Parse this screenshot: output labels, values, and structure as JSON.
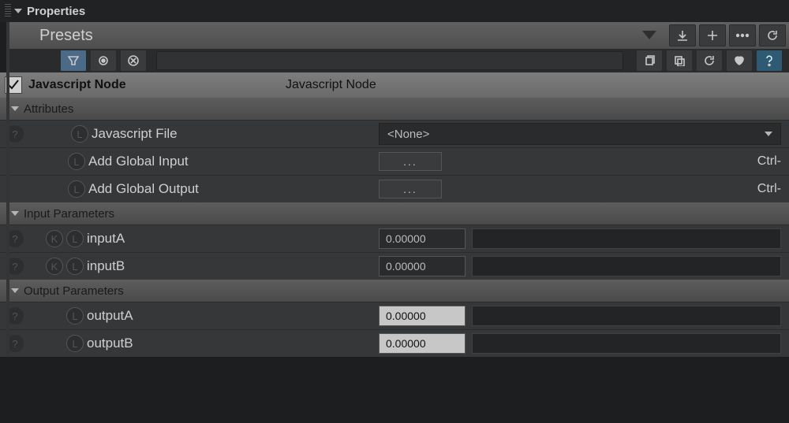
{
  "panel_title": "Properties",
  "presets_label": "Presets",
  "node": {
    "label_left": "Javascript Node",
    "label_right": "Javascript Node"
  },
  "sections": {
    "attributes": {
      "title": "Attributes",
      "rows": {
        "js_file": {
          "label": "Javascript File",
          "value": "<None>"
        },
        "add_in": {
          "label": "Add Global Input",
          "button": "...",
          "shortcut": "Ctrl-"
        },
        "add_out": {
          "label": "Add Global Output",
          "button": "...",
          "shortcut": "Ctrl-"
        }
      }
    },
    "input_params": {
      "title": "Input Parameters",
      "rows": {
        "a": {
          "label": "inputA",
          "value": "0.00000"
        },
        "b": {
          "label": "inputB",
          "value": "0.00000"
        }
      }
    },
    "output_params": {
      "title": "Output Parameters",
      "rows": {
        "a": {
          "label": "outputA",
          "value": "0.00000"
        },
        "b": {
          "label": "outputB",
          "value": "0.00000"
        }
      }
    }
  }
}
